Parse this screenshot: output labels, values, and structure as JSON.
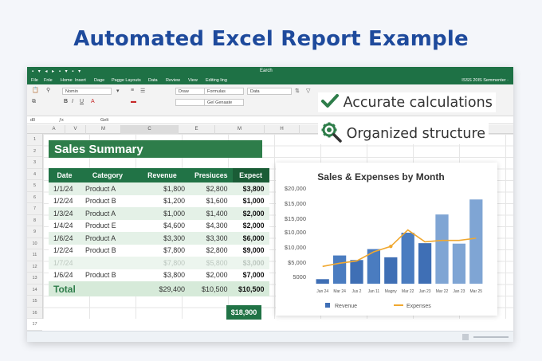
{
  "headline": "Automated Excel Report Example",
  "window": {
    "title": "Earch",
    "menu": [
      "File",
      "Fnle",
      "Home",
      "Insert",
      "Dage",
      "Pagge Layouts",
      "Data",
      "Review",
      "View",
      "Editing ling"
    ],
    "menu_right": "ISSS 20IS   Semmenter  ·",
    "ribbon": {
      "font": "Nomin",
      "style": "Draw",
      "formulas": "Formulas",
      "general": "Gel Genaate",
      "data": "Data"
    },
    "formula_bar": {
      "cell_ref": "d0",
      "content": "Gelt"
    },
    "columns": [
      "A",
      "V",
      "M",
      "C",
      "E",
      "M",
      "H"
    ],
    "rows": [
      "1",
      "2",
      "3",
      "4",
      "5",
      "6",
      "7",
      "8",
      "9",
      "10",
      "11",
      "12",
      "13",
      "14",
      "15",
      "16",
      "17",
      "18",
      "20",
      "21"
    ]
  },
  "summary": {
    "title": "Sales Summary",
    "headers": [
      "Date",
      "Category",
      "Revenue",
      "Presiuces",
      "Expect"
    ],
    "rows": [
      {
        "date": "1/1/24",
        "category": "Product A",
        "revenue": "$1,800",
        "presiuces": "$2,800",
        "expect": "$3,800"
      },
      {
        "date": "1/2/24",
        "category": "Product B",
        "revenue": "$1,200",
        "presiuces": "$1,600",
        "expect": "$1,000"
      },
      {
        "date": "1/3/24",
        "category": "Product A",
        "revenue": "$1,000",
        "presiuces": "$1,400",
        "expect": "$2,000"
      },
      {
        "date": "1/4/24",
        "category": "Product E",
        "revenue": "$4,600",
        "presiuces": "$4,300",
        "expect": "$2,000"
      },
      {
        "date": "1/6/24",
        "category": "Product A",
        "revenue": "$3,300",
        "presiuces": "$3,300",
        "expect": "$6,000"
      },
      {
        "date": "1/2/24",
        "category": "Product B",
        "revenue": "$7,800",
        "presiuces": "$2,800",
        "expect": "$9,000"
      },
      {
        "date": "1/7/24",
        "category": "",
        "revenue": "$7,800",
        "presiuces": "$5,800",
        "expect": "$3,000"
      },
      {
        "date": "1/6/24",
        "category": "Product B",
        "revenue": "$3,800",
        "presiuces": "$2,000",
        "expect": "$7,000"
      }
    ],
    "total": {
      "label": "Total",
      "revenue": "$29,400",
      "presiuces": "$10,500",
      "expect": "$10,500"
    },
    "grand_total": "$18,900"
  },
  "bullets": [
    {
      "icon": "checkmark-icon",
      "text": "Accurate calculations"
    },
    {
      "icon": "gear-search-icon",
      "text": "Organized structure"
    }
  ],
  "colors": {
    "excel_green": "#1e7145",
    "header_green": "#217346",
    "bar_blue": "#3f6fb5",
    "line_orange": "#f0a830",
    "headline_blue": "#1e4a9c"
  },
  "chart_data": {
    "type": "bar",
    "title": "Sales & Expenses by Month",
    "categories": [
      "Jan 24",
      "Mar 24",
      "Jus 2",
      "Jan 11",
      "Magny",
      "Mar 22",
      "Jan 23",
      "Mar 22",
      "Jan 23",
      "Mar 25"
    ],
    "series": [
      {
        "name": "Revenue",
        "type": "bar",
        "values": [
          1000,
          6200,
          5200,
          7600,
          5800,
          11200,
          8900,
          15200,
          8800,
          18500
        ]
      },
      {
        "name": "Expenses",
        "type": "line",
        "values": [
          3800,
          4500,
          5000,
          7000,
          8200,
          11800,
          9200,
          9500,
          9500,
          10000
        ]
      }
    ],
    "yticks": [
      "5000",
      "$5,000",
      "$10,000",
      "$10,000",
      "$15,000",
      "$15,000",
      "$20,000"
    ],
    "ylim": [
      0,
      21000
    ],
    "legend": "bottom"
  }
}
